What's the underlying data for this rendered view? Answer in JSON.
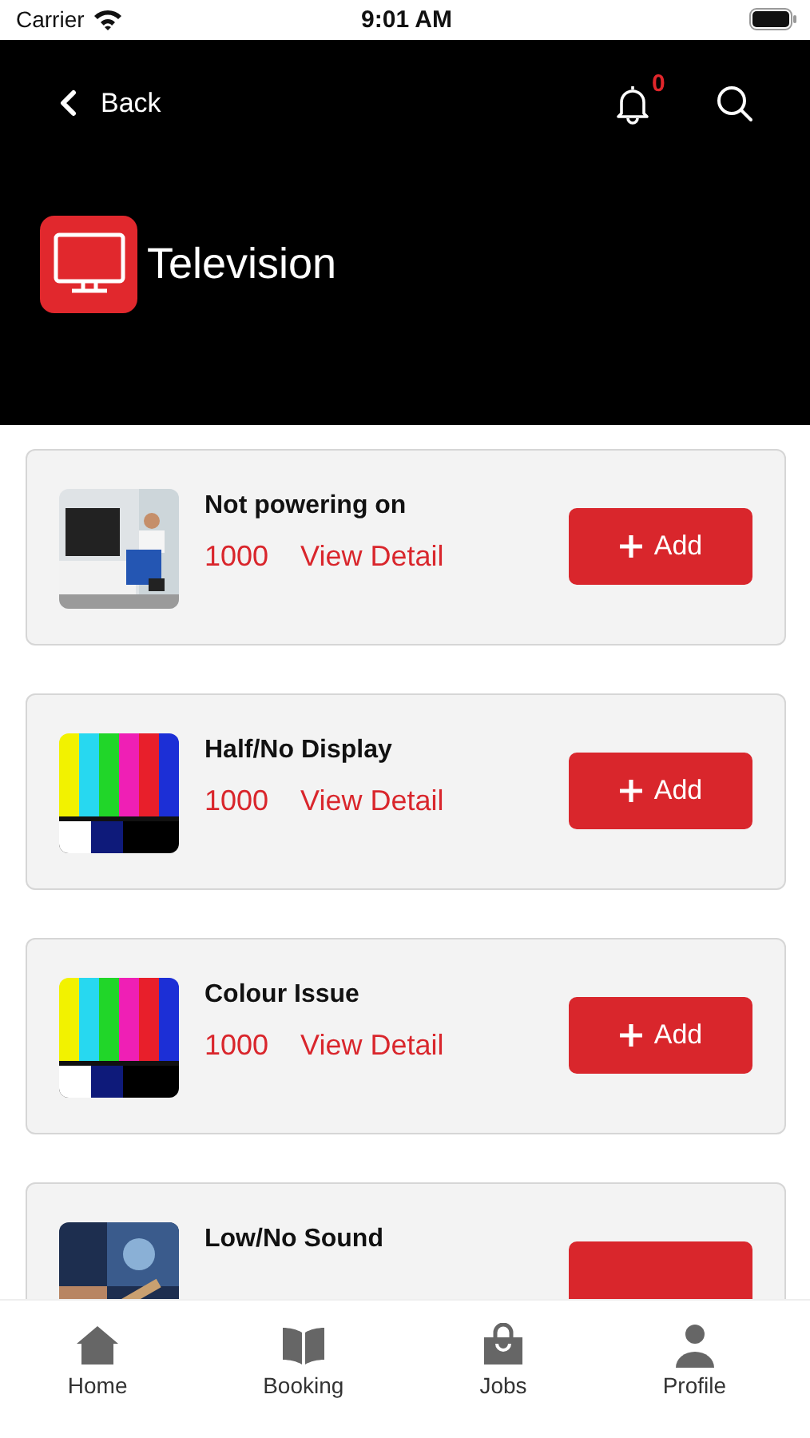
{
  "status_bar": {
    "carrier": "Carrier",
    "time": "9:01 AM"
  },
  "header": {
    "back_label": "Back",
    "notification_count": "0",
    "title": "Television"
  },
  "services": [
    {
      "title": "Not powering on",
      "price": "1000",
      "detail_link": "View Detail",
      "add_label": "Add"
    },
    {
      "title": "Half/No Display",
      "price": "1000",
      "detail_link": "View Detail",
      "add_label": "Add"
    },
    {
      "title": "Colour Issue",
      "price": "1000",
      "detail_link": "View Detail",
      "add_label": "Add"
    },
    {
      "title": "Low/No Sound"
    }
  ],
  "tab_bar": [
    {
      "label": "Home"
    },
    {
      "label": "Booking"
    },
    {
      "label": "Jobs"
    },
    {
      "label": "Profile"
    }
  ]
}
